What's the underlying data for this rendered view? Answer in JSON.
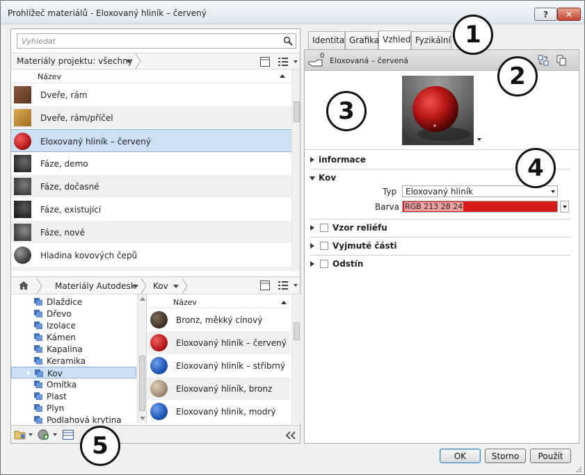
{
  "window": {
    "title": "Prohlížeč materiálů - Eloxovaný hliník – červený",
    "help_label": "?",
    "close_label": "✕"
  },
  "search": {
    "placeholder": "Vyhledat"
  },
  "project": {
    "crumb": "Materiály projektu: všechny",
    "column_header": "Název",
    "materials": [
      {
        "label": "Dveře, rám",
        "thumb": "wood-dark"
      },
      {
        "label": "Dveře, rám/příčel",
        "thumb": "wood-light"
      },
      {
        "label": "Eloxovaný hliník – červený",
        "thumb": "red-sphere",
        "selected": true
      },
      {
        "label": "Fáze, demo",
        "thumb": "dark-cube"
      },
      {
        "label": "Fáze, dočasné",
        "thumb": "dark-cube"
      },
      {
        "label": "Fáze, existující",
        "thumb": "dark-cube"
      },
      {
        "label": "Fáze, nové",
        "thumb": "dark-cube"
      },
      {
        "label": "Hladina kovových čepů",
        "thumb": "dark-sphere"
      }
    ]
  },
  "library": {
    "crumb_root": "Materiály Autodesk",
    "crumb_child": "Kov",
    "column_header": "Název",
    "tree": [
      {
        "label": "Dlaždice"
      },
      {
        "label": "Dřevo"
      },
      {
        "label": "Izolace"
      },
      {
        "label": "Kámen"
      },
      {
        "label": "Kapalina"
      },
      {
        "label": "Keramika"
      },
      {
        "label": "Kov",
        "selected": true
      },
      {
        "label": "Omítka"
      },
      {
        "label": "Plast"
      },
      {
        "label": "Plyn"
      },
      {
        "label": "Podlahová krytina"
      }
    ],
    "items": [
      {
        "label": "Bronz, měkký cínový",
        "thumb": "brown"
      },
      {
        "label": "Eloxovaný hliník – červený",
        "thumb": "red"
      },
      {
        "label": "Eloxovaný hliník – stříbrný",
        "thumb": "blue"
      },
      {
        "label": "Eloxovaný hliník, bronz",
        "thumb": "tan"
      },
      {
        "label": "Eloxovaný hliník, modrý",
        "thumb": "blue"
      }
    ]
  },
  "tabs": [
    {
      "label": "Identita"
    },
    {
      "label": "Grafika"
    },
    {
      "label": "Vzhled",
      "active": true
    },
    {
      "label": "Fyzikální"
    }
  ],
  "asset": {
    "usage_count": "0",
    "name": "Eloxovaná – červená"
  },
  "sections": {
    "info": "informace",
    "metal": "Kov",
    "relief": "Vzor reliéfu",
    "cutouts": "Vyjmuté části",
    "tint": "Odstín"
  },
  "metal": {
    "type_label": "Typ",
    "type_value": "Eloxovaný hliník",
    "color_label": "Barva",
    "color_value": "RGB 213 28 24",
    "color_hex": "#d51c18"
  },
  "buttons": {
    "ok": "OK",
    "cancel": "Storno",
    "apply": "Použít"
  },
  "callouts": [
    "1",
    "2",
    "3",
    "4",
    "5"
  ]
}
